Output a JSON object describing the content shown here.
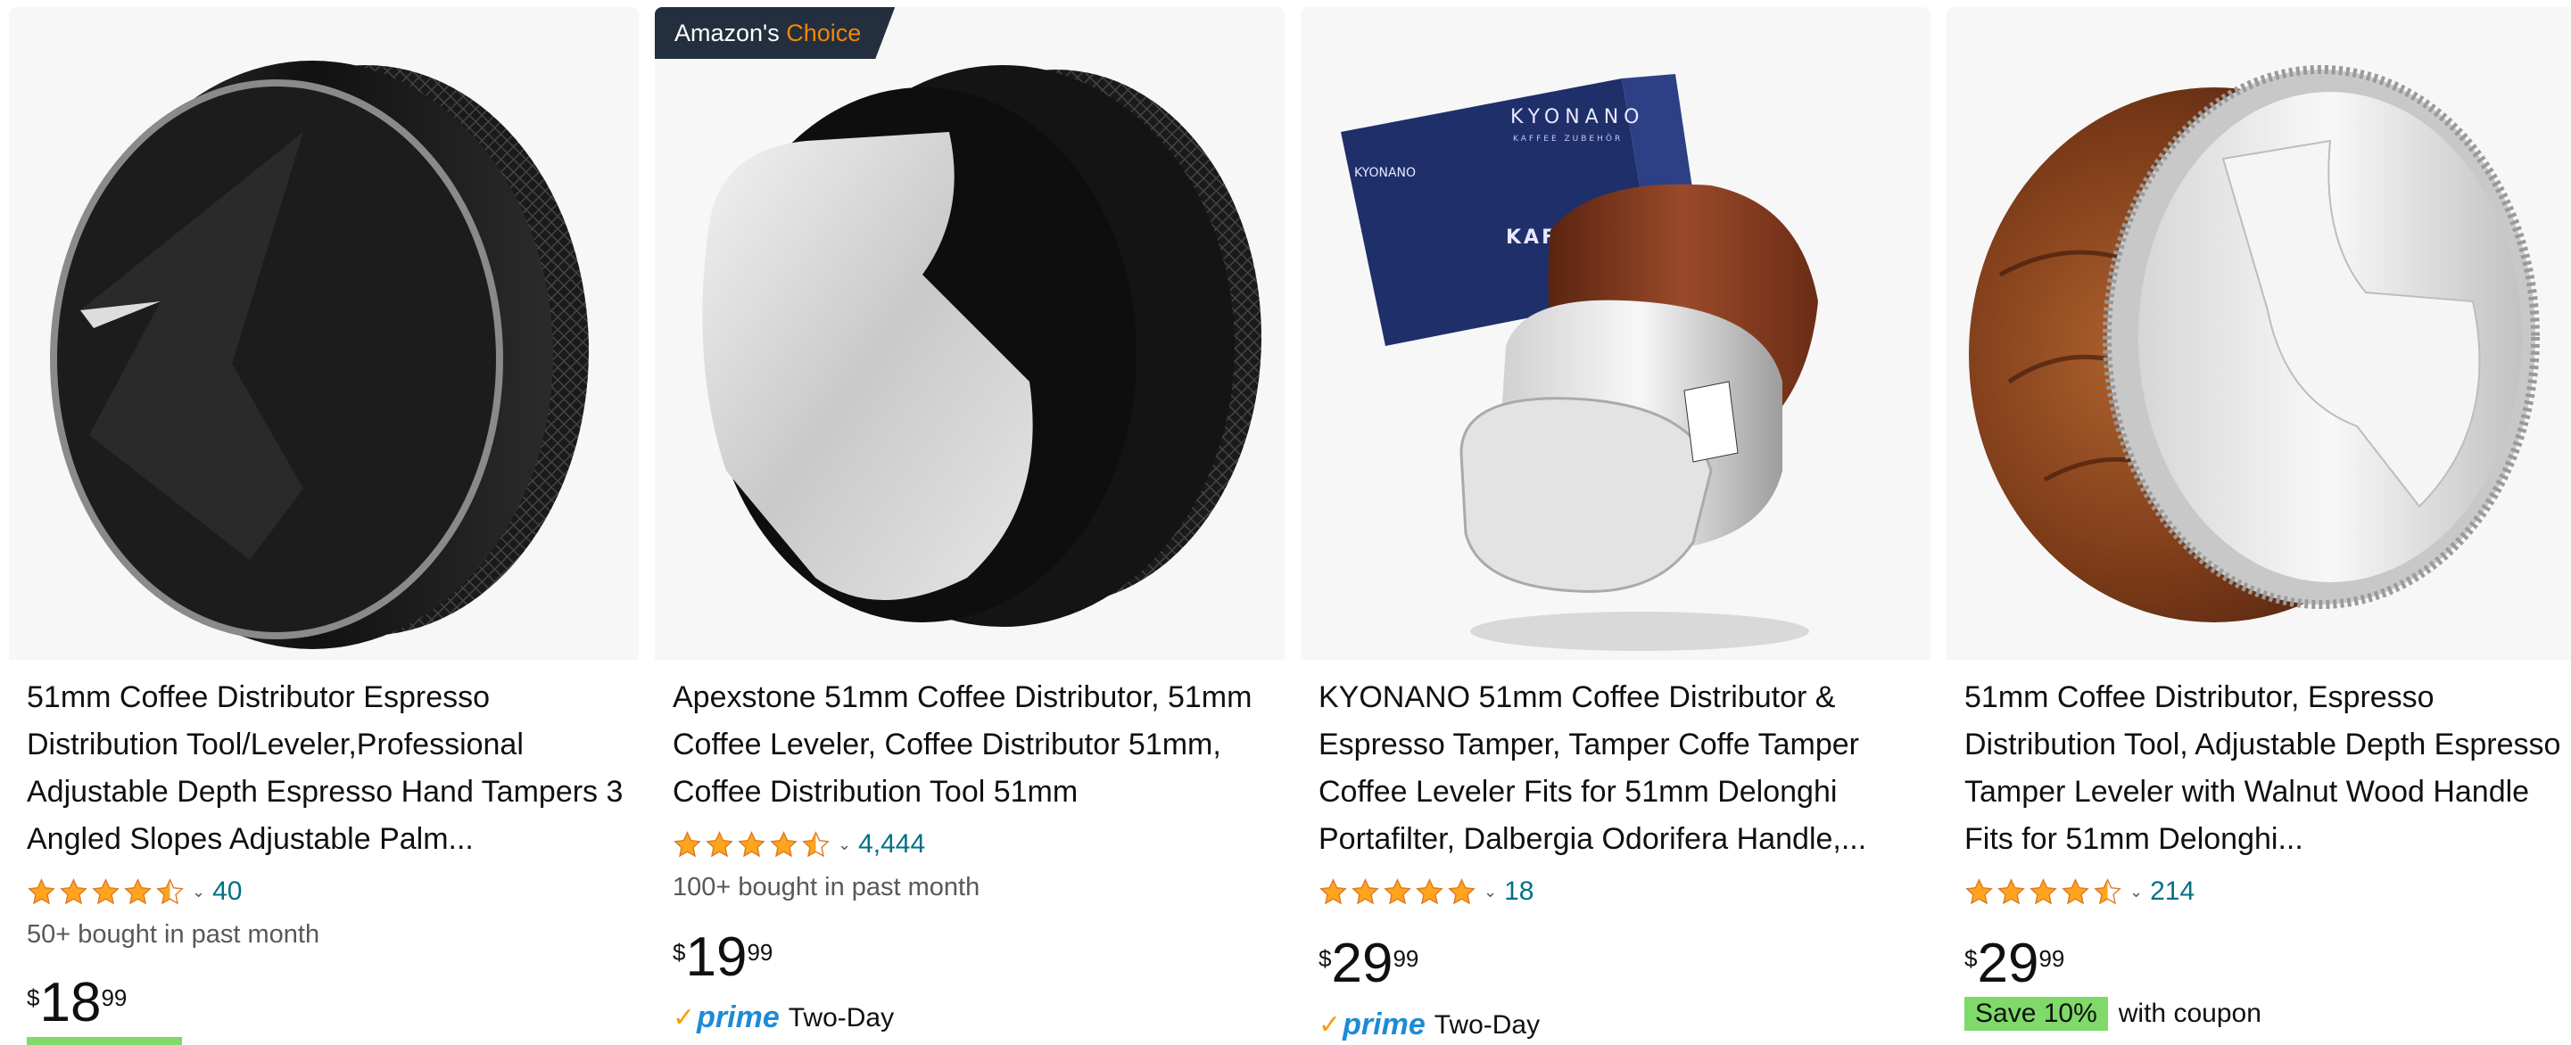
{
  "products": [
    {
      "title": "51mm Coffee Distributor Espresso Distribution Tool/Leveler,Professional Adjustable Depth Espresso Hand Tampers 3 Angled Slopes Adjustable Palm...",
      "rating": 4.5,
      "review_count": "40",
      "bought": "50+ bought in past month",
      "price_symbol": "$",
      "price_whole": "18",
      "price_fraction": "99"
    },
    {
      "badge_prefix": "Amazon's",
      "badge_accent": "Choice",
      "title": "Apexstone 51mm Coffee Distributor, 51mm Coffee Leveler, Coffee Distributor 51mm, Coffee Distribution Tool 51mm",
      "rating": 4.5,
      "review_count": "4,444",
      "bought": "100+ bought in past month",
      "price_symbol": "$",
      "price_whole": "19",
      "price_fraction": "99",
      "delivery_logo": "prime",
      "delivery_text": "Two-Day"
    },
    {
      "title": "KYONANO 51mm Coffee Distributor & Espresso Tamper, Tamper Coffe Tamper Coffee Leveler Fits for 51mm Delonghi Portafilter, Dalbergia Odorifera Handle,...",
      "rating": 5,
      "review_count": "18",
      "price_symbol": "$",
      "price_whole": "29",
      "price_fraction": "99",
      "delivery_logo": "prime",
      "delivery_text": "Two-Day",
      "box_brand": "KYONANO",
      "box_sub": "KAFFEE ZUBEHÖR",
      "box_side": "KYONANO",
      "box_front": "KAFFE"
    },
    {
      "title": "51mm Coffee Distributor, Espresso Distribution Tool, Adjustable Depth Espresso Tamper Leveler with Walnut Wood Handle Fits for 51mm Delonghi...",
      "rating": 4.5,
      "review_count": "214",
      "price_symbol": "$",
      "price_whole": "29",
      "price_fraction": "99",
      "coupon_tag": "Save 10%",
      "coupon_text": "with coupon"
    }
  ],
  "colors": {
    "star": "#ffa41c",
    "star_outline": "#de7921",
    "link": "#007185",
    "prime_blue": "#1d8bd6",
    "coupon_green": "#7fda69",
    "badge_bg": "#232f3e",
    "badge_accent": "#f08804"
  }
}
